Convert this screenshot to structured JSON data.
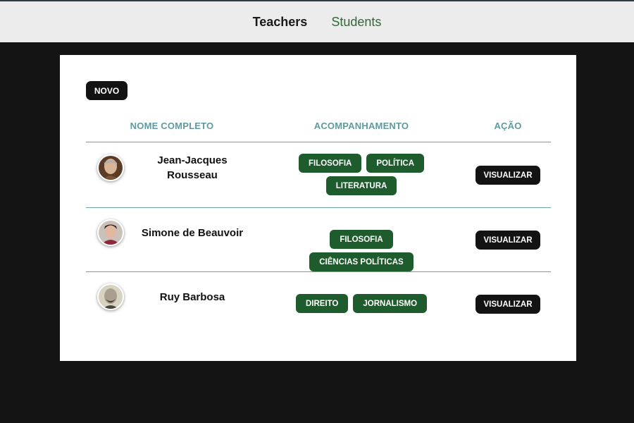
{
  "nav": {
    "items": [
      {
        "label": "Teachers",
        "active": true
      },
      {
        "label": "Students",
        "active": false
      }
    ]
  },
  "toolbar": {
    "new_label": "NOVO"
  },
  "table": {
    "columns": [
      "NOME COMPLETO",
      "ACOMPANHAMENTO",
      "AÇÃO"
    ],
    "rows": [
      {
        "name_line1": "Jean-Jacques",
        "name_line2": "Rousseau",
        "tags": [
          "FILOSOFIA",
          "POLÍTICA",
          "LITERATURA"
        ],
        "action": "VISUALIZAR"
      },
      {
        "name_line1": "Simone de Beauvoir",
        "name_line2": "",
        "tags": [
          "FILOSOFIA",
          "CIÊNCIAS POLÍTICAS"
        ],
        "action": "VISUALIZAR"
      },
      {
        "name_line1": "Ruy Barbosa",
        "name_line2": "",
        "tags": [
          "DIREITO",
          "JORNALISMO"
        ],
        "action": "VISUALIZAR"
      }
    ]
  },
  "colors": {
    "page_background": "#141414",
    "topbar_background": "#ececec",
    "header_text": "#5e9aa0",
    "tag_green": "#1f5c2d",
    "button_dark": "#131313",
    "divider": "#6aa1a3"
  }
}
